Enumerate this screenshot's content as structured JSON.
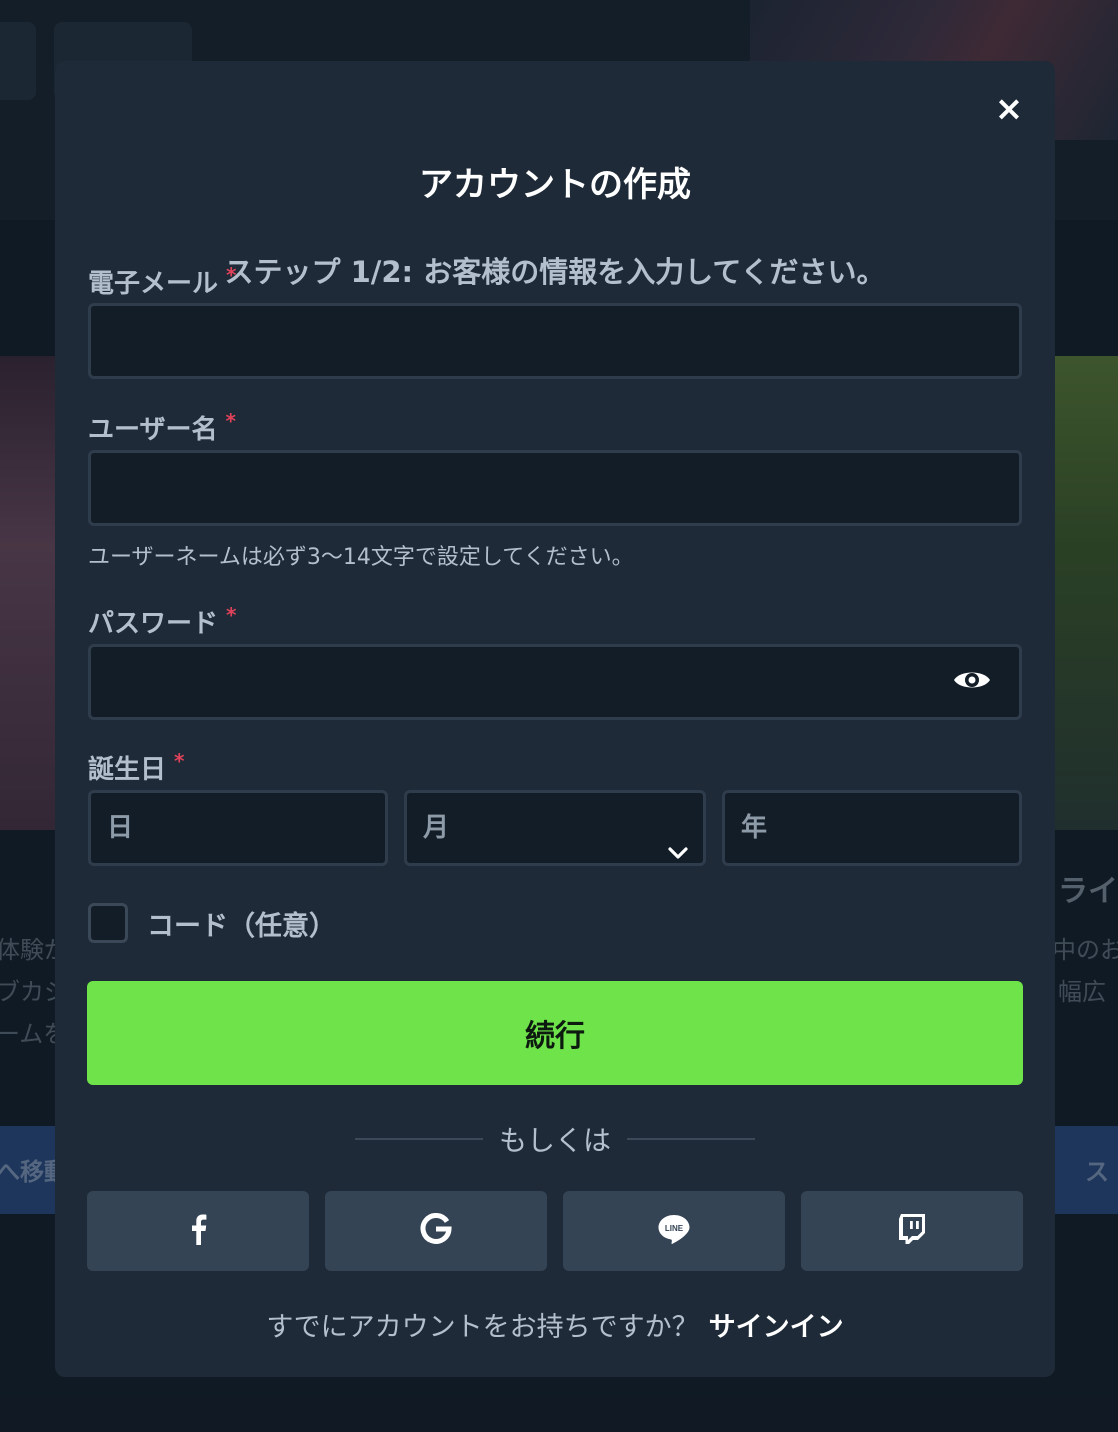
{
  "modal": {
    "title": "アカウントの作成",
    "close_label": "×",
    "step_text": "ステップ 1/2: お客様の情報を入力してください。"
  },
  "form": {
    "email": {
      "label": "電子メール",
      "required_mark": "*",
      "value": ""
    },
    "username": {
      "label": "ユーザー名",
      "required_mark": "*",
      "value": "",
      "hint": "ユーザーネームは必ず3〜14文字で設定してください。"
    },
    "password": {
      "label": "パスワード",
      "required_mark": "*",
      "value": "",
      "visibility_icon": "eye-icon"
    },
    "birthday": {
      "label": "誕生日",
      "required_mark": "*",
      "day_placeholder": "日",
      "month_placeholder": "月",
      "year_placeholder": "年"
    },
    "code": {
      "label": "コード（任意）",
      "checked": false
    }
  },
  "actions": {
    "continue_label": "続行",
    "or_label": "もしくは"
  },
  "social": [
    {
      "name": "facebook",
      "icon": "facebook-icon"
    },
    {
      "name": "google",
      "icon": "google-icon"
    },
    {
      "name": "line",
      "icon": "line-icon",
      "icon_text": "LINE"
    },
    {
      "name": "twitch",
      "icon": "twitch-icon"
    }
  ],
  "signin": {
    "question": "すでにアカウントをお持ちですか？",
    "link": "サインイン"
  },
  "background": {
    "left_texts": [
      "体験が",
      "ブカジ",
      "ームを"
    ],
    "left_button": "へ移動",
    "right_title": "ライ",
    "right_texts": [
      "中のお",
      "幅広"
    ],
    "right_button": "ス"
  },
  "colors": {
    "accent_green": "#6fe34a",
    "modal_bg": "#1e2a37",
    "required_red": "#e0425a"
  }
}
